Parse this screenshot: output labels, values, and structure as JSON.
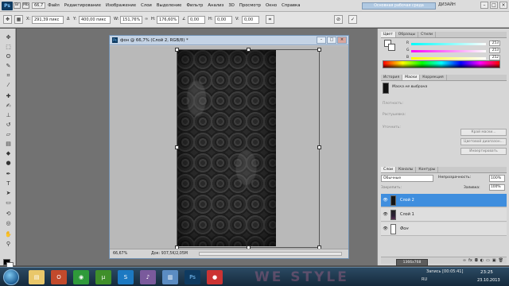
{
  "app": {
    "logo": "Ps"
  },
  "menu": {
    "items": [
      "Файл",
      "Редактирование",
      "Изображение",
      "Слои",
      "Выделение",
      "Фильтр",
      "Анализ",
      "3D",
      "Просмотр",
      "Окно",
      "Справка"
    ],
    "zoom": "66,7",
    "workspace": "Основная рабочая среда",
    "design_label": "ДИЗАЙН"
  },
  "options": {
    "x_value": "291,39 пикс",
    "y_value": "400,00 пикс",
    "w_value": "151,76%",
    "h_value": "176,60%",
    "angle_value": "0,00",
    "h_skew": "0,00",
    "v_skew": "0,00"
  },
  "document": {
    "title": "фон @ 66,7% (Слой 2, RGB/8) *",
    "zoom": "66,67%",
    "size": "Док: 937,5K/2,05M"
  },
  "color_panel": {
    "tabs": [
      "Цвет",
      "Образцы",
      "Стили"
    ],
    "channels": [
      {
        "label": "R",
        "value": "253"
      },
      {
        "label": "G",
        "value": "253"
      },
      {
        "label": "B",
        "value": "252"
      }
    ]
  },
  "masks_panel": {
    "tabs": [
      "История",
      "Маски",
      "Коррекция"
    ],
    "state": "Маска не выбрана",
    "density_label": "Плотность:",
    "feather_label": "Растушевка:",
    "refine_label": "Уточнить:",
    "buttons": [
      "Край маски...",
      "Цветовой диапазон...",
      "Инвертировать"
    ]
  },
  "layers_panel": {
    "tabs": [
      "Слои",
      "Каналы",
      "Контуры"
    ],
    "blend_mode": "Обычные",
    "opacity_label": "Непрозрачность:",
    "opacity": "100%",
    "lock_label": "Закрепить:",
    "fill_label": "Заливка:",
    "fill": "100%",
    "layers": [
      {
        "name": "Слой 2",
        "selected": true
      },
      {
        "name": "Слой 1",
        "selected": false
      },
      {
        "name": "Фон",
        "selected": false
      }
    ]
  },
  "tooltip": "1366x768",
  "taskbar": {
    "record": "Запись [00:05:41]",
    "lang": "RU",
    "time": "23:25",
    "date": "23.10.2013",
    "watermark": "WE STYLE"
  }
}
